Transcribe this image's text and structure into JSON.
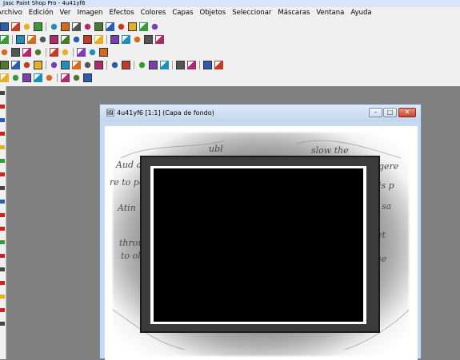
{
  "window_title": "Jasc Paint Shop Pro - 4u41yf6",
  "menu": [
    "Archivo",
    "Edición",
    "Ver",
    "Imagen",
    "Efectos",
    "Colores",
    "Capas",
    "Objetos",
    "Seleccionar",
    "Máscaras",
    "Ventana",
    "Ayuda"
  ],
  "toolbars": [
    {
      "icons": [
        "paint-icon",
        "rect-yellow-icon",
        "bucket-icon",
        "sheet-icon",
        "sep",
        "palette-icon",
        "palette-red-icon",
        "gradient-icon",
        "blur-icon",
        "browser-icon",
        "doc-icon",
        "globe-icon",
        "stamp-icon",
        "square-blue-icon",
        "lines-icon"
      ]
    },
    {
      "icons": [
        "color-icon",
        "sep",
        "img-icon",
        "blue-doc-icon",
        "chart-icon",
        "grid-icon",
        "text-icon",
        "layer-icon",
        "frame-icon",
        "effect-icon",
        "sep",
        "selection-icon",
        "dropper-icon",
        "paint-brush-icon",
        "fill-icon",
        "picture-icon"
      ]
    },
    {
      "icons": [
        "undo-small-icon",
        "trash-icon",
        "layers-icon",
        "copy-icon",
        "sep",
        "brush-icon",
        "mask-icon",
        "sep",
        "move-icon",
        "resize-icon",
        "rotate-icon"
      ]
    },
    {
      "icons": [
        "new-file-icon",
        "open-icon",
        "save-icon",
        "print-icon",
        "sep",
        "undo-icon",
        "redo-icon",
        "cut-icon",
        "copy2-icon",
        "paste-icon",
        "sep",
        "monitor-icon",
        "settings-icon",
        "sep",
        "zoom-icon",
        "palette2-icon",
        "histogram-icon",
        "sep",
        "layer-palette-icon",
        "overview-icon",
        "sep",
        "help-icon",
        "lock-icon"
      ]
    },
    {
      "icons": [
        "crosshair-icon",
        "target-icon",
        "left-arrow-icon",
        "left-arrow-2-icon",
        "left-arrow-3-icon",
        "sep",
        "globe2-icon",
        "color-swap-icon",
        "grid2-icon"
      ]
    }
  ],
  "document": {
    "title": "4u41yf6 [1:1] (Capa de fondo)",
    "minimize": "–",
    "maximize": "□",
    "close": "✕"
  },
  "colors": {
    "workspace": "#808080",
    "frame_inner": "#000000",
    "frame_mid": "#ffffff",
    "frame_outer": "#3b3b3b"
  }
}
